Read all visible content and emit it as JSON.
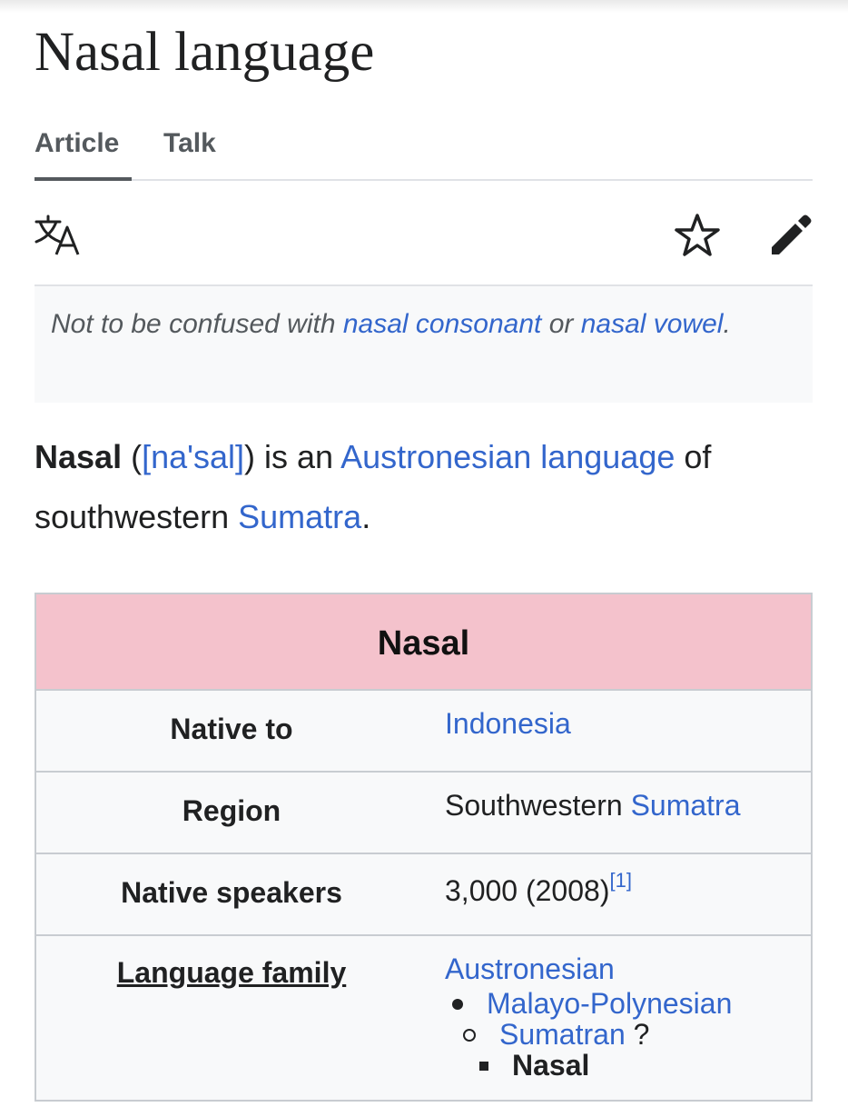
{
  "page": {
    "title": "Nasal language",
    "tabs": [
      {
        "label": "Article",
        "selected": true
      },
      {
        "label": "Talk",
        "selected": false
      }
    ]
  },
  "toolbar": {
    "translate_icon": "translate-icon",
    "watch_icon": "star-icon",
    "edit_icon": "pencil-icon"
  },
  "hatnote": {
    "prefix": "Not to be confused with ",
    "link1": "nasal consonant",
    "middle": " or ",
    "link2": "nasal vowel",
    "suffix": "."
  },
  "lead": {
    "bold": "Nasal",
    "open_paren": " (",
    "ipa": "[na'sal]",
    "after_ipa": ") is an ",
    "link_family": "Austronesian language",
    "after_family": " of southwestern ",
    "link_region": "Sumatra",
    "end": "."
  },
  "infobox": {
    "title": "Nasal",
    "native_to_label": "Native to",
    "native_to_value": "Indonesia",
    "region_label": "Region",
    "region_text": "Southwestern ",
    "region_link": "Sumatra",
    "speakers_label": "Native speakers",
    "speakers_value": "3,000 (2008)",
    "speakers_ref": "[1]",
    "family_label": "Language family",
    "family": {
      "level0": "Austronesian",
      "level1": "Malayo-Polynesian",
      "level2": "Sumatran",
      "level2_note": " ?",
      "level3": "Nasal"
    }
  },
  "colors": {
    "link": "#3366cc",
    "infobox_header": "#f4c2cc",
    "text": "#202122"
  }
}
